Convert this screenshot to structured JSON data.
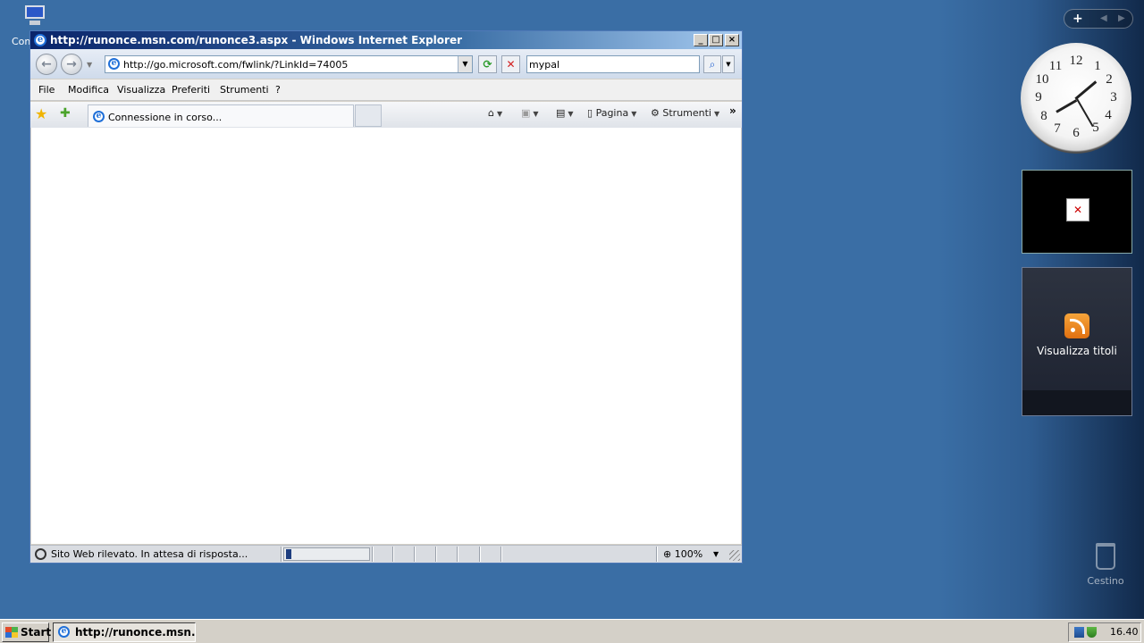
{
  "desktop": {
    "computer_icon_label": "Com",
    "recycle_bin_label": "Cestino"
  },
  "sidebar": {
    "add_label": "+",
    "prev_label": "◀",
    "next_label": "▶",
    "clock": {
      "numbers": [
        "12",
        "1",
        "2",
        "3",
        "4",
        "5",
        "6",
        "7",
        "8",
        "9",
        "10",
        "11"
      ],
      "time": "16:40"
    },
    "feed_gadget_label": "Visualizza titoli",
    "broken_gadget_icon": "broken-image-icon"
  },
  "window": {
    "title": "http://runonce.msn.com/runonce3.aspx - Windows Internet Explorer",
    "controls": {
      "minimize": "_",
      "maximize": "□",
      "close": "×"
    },
    "address": "http://go.microsoft.com/fwlink/?LinkId=74005",
    "search_value": "mypal",
    "menu": [
      "File",
      "Modifica",
      "Visualizza",
      "Preferiti",
      "Strumenti",
      "?"
    ],
    "tab_title": "Connessione in corso...",
    "commands": {
      "page": "Pagina",
      "tools": "Strumenti"
    },
    "status_text": "Sito Web rilevato. In attesa di risposta...",
    "zoom": "100%",
    "progress_fraction": 0.06
  },
  "taskbar": {
    "start_label": "Start",
    "task_label": "http://runonce.msn.c...",
    "clock": "16.40"
  },
  "colors": {
    "desktop": "#3a6ea5",
    "titlebar_start": "#0a246a",
    "progress": "#1d3e80"
  }
}
